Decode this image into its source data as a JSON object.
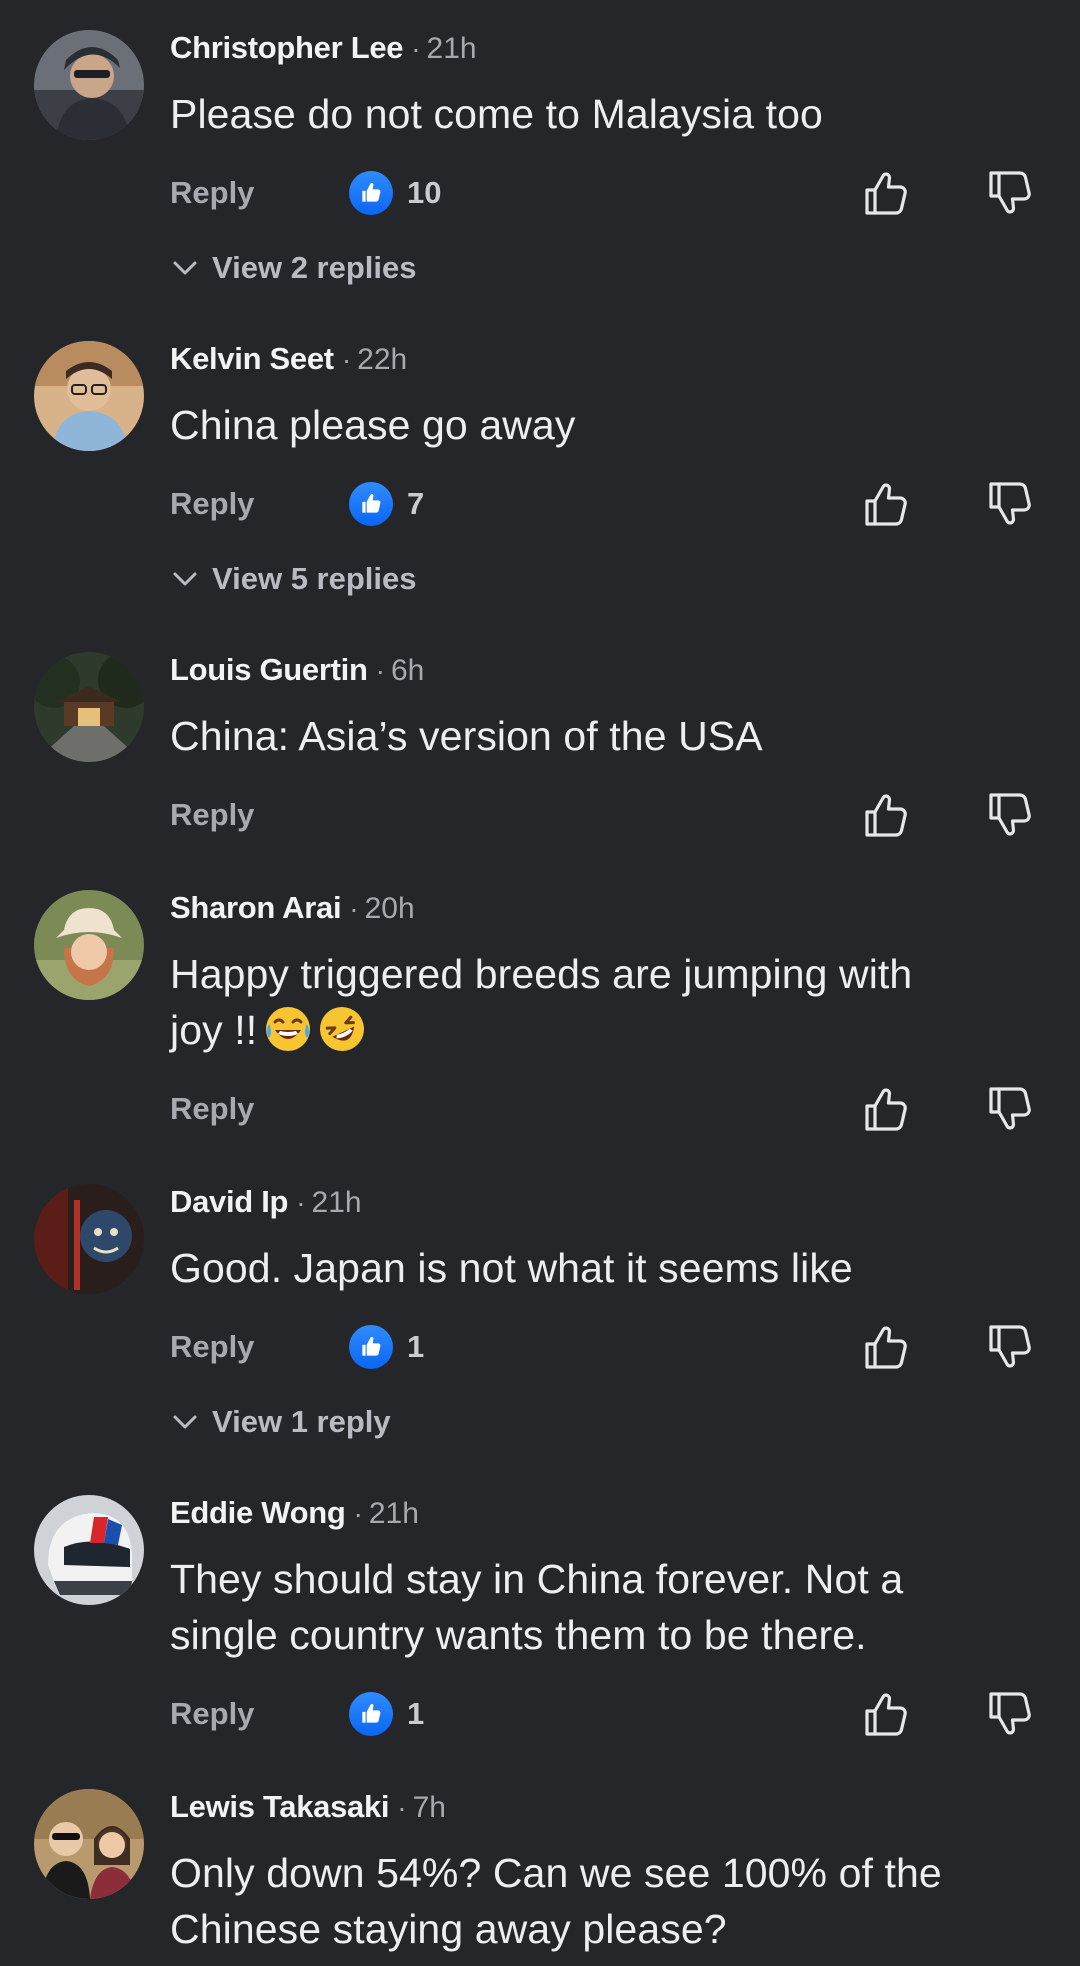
{
  "comments": [
    {
      "author": "Christopher Lee",
      "time": "21h",
      "text": "Please do not come to Malaysia too",
      "reply_label": "Reply",
      "likes": "10",
      "view_replies": "View 2 replies",
      "avatar_icon": "person-hoodie-avatar"
    },
    {
      "author": "Kelvin Seet",
      "time": "22h",
      "text": "China please go away",
      "reply_label": "Reply",
      "likes": "7",
      "view_replies": "View 5 replies",
      "avatar_icon": "person-glasses-avatar"
    },
    {
      "author": "Louis Guertin",
      "time": "6h",
      "text": "China: Asia’s version of the USA",
      "reply_label": "Reply",
      "likes": null,
      "view_replies": null,
      "avatar_icon": "temple-avatar"
    },
    {
      "author": "Sharon Arai",
      "time": "20h",
      "text_line1": "Happy triggered breeds are jumping with",
      "text_line2": "joy !!",
      "emojis": [
        "face-with-tears-of-joy-icon",
        "rolling-on-floor-laughing-icon"
      ],
      "reply_label": "Reply",
      "likes": null,
      "view_replies": null,
      "avatar_icon": "woman-bucket-hat-avatar"
    },
    {
      "author": "David Ip",
      "time": "21h",
      "text": "Good. Japan is not what it seems like",
      "reply_label": "Reply",
      "likes": "1",
      "view_replies": "View 1 reply",
      "avatar_icon": "deity-statue-avatar"
    },
    {
      "author": "Eddie Wong",
      "time": "21h",
      "text_line1": "They should stay in China forever. Not a",
      "text_line2": "single country wants them to be there.",
      "reply_label": "Reply",
      "likes": "1",
      "view_replies": null,
      "avatar_icon": "racing-helmet-avatar"
    },
    {
      "author": "Lewis Takasaki",
      "time": "7h",
      "text_line1": "Only down 54%? Can we see 100% of the",
      "text_line2": "Chinese staying away please?",
      "reply_label": null,
      "likes": null,
      "view_replies": null,
      "avatar_icon": "two-people-avatar"
    }
  ],
  "colors": {
    "background": "#252629",
    "like_badge": "#1877f2",
    "secondary_text": "#a7a9ae"
  },
  "icons": {
    "like": "thumbs-up-icon",
    "dislike": "thumbs-down-icon",
    "expand": "chevron-down-icon"
  }
}
